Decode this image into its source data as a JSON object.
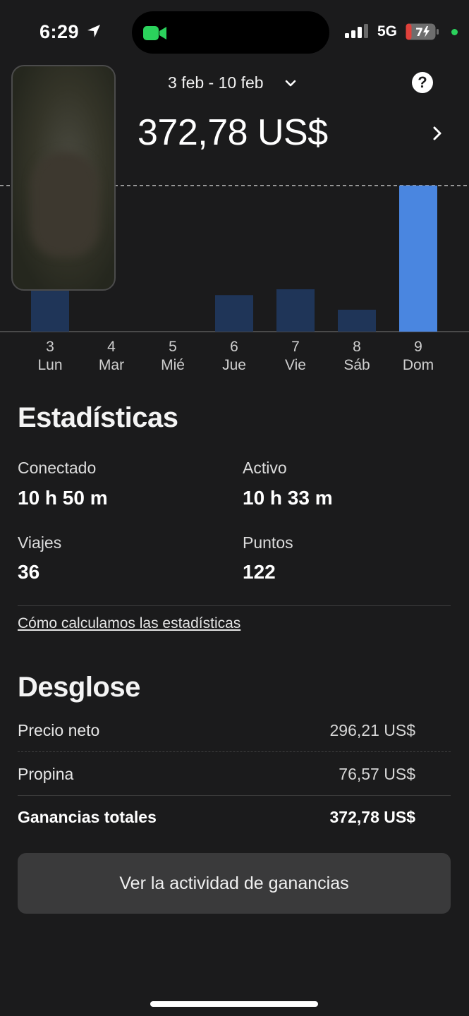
{
  "status_bar": {
    "time": "6:29",
    "network": "5G",
    "battery": "7"
  },
  "header": {
    "date_range": "3 feb - 10 feb",
    "total": "372,78 US$",
    "help_glyph": "?"
  },
  "chart_data": {
    "type": "bar",
    "categories": [
      "3 Lun",
      "4 Mar",
      "5 Mié",
      "6 Jue",
      "7 Vie",
      "8 Sáb",
      "9 Dom"
    ],
    "day_numbers": [
      "3",
      "4",
      "5",
      "6",
      "7",
      "8",
      "9"
    ],
    "day_names": [
      "Lun",
      "Mar",
      "Mié",
      "Jue",
      "Vie",
      "Sáb",
      "Dom"
    ],
    "values": [
      0.28,
      0,
      0,
      0.25,
      0.29,
      0.15,
      1.0
    ],
    "selected_index": 6,
    "colors": {
      "bar": "#1f3558",
      "selected": "#4a86e0",
      "reference_line": "#bfbfbf"
    }
  },
  "stats": {
    "title": "Estadísticas",
    "online_label": "Conectado",
    "online_value": "10 h 50 m",
    "active_label": "Activo",
    "active_value": "10 h 33 m",
    "trips_label": "Viajes",
    "trips_value": "36",
    "points_label": "Puntos",
    "points_value": "122",
    "how_link": "Cómo calculamos las estadísticas"
  },
  "breakdown": {
    "title": "Desglose",
    "rows": [
      {
        "label": "Precio neto",
        "value": "296,21 US$"
      },
      {
        "label": "Propina",
        "value": "76,57 US$"
      },
      {
        "label": "Ganancias totales",
        "value": "372,78 US$"
      }
    ]
  },
  "cta": {
    "label": "Ver la actividad de ganancias"
  }
}
